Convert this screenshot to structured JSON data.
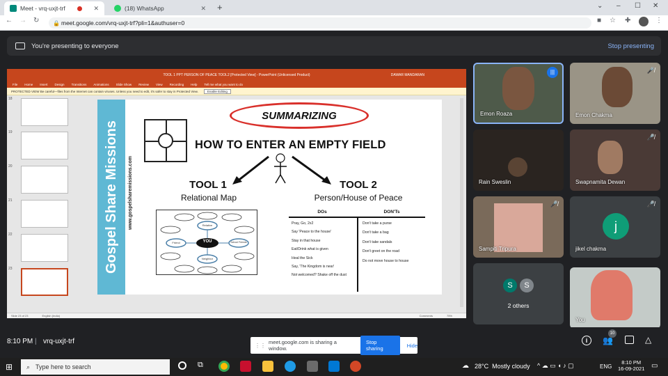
{
  "browser": {
    "tabs": [
      {
        "label": "Meet - vrq-uxjt-trf"
      },
      {
        "label": "(18) WhatsApp"
      }
    ],
    "new_tab": "+",
    "url": "meet.google.com/vrq-uxjt-trf?pli=1&authuser=0"
  },
  "banner": {
    "text": "You're presenting to everyone",
    "stop_label": "Stop presenting"
  },
  "ppt": {
    "title": "TOOL 1 PPT PERSON OF PEACE TOOL2 [Protected View] - PowerPoint (Unlicensed Product)",
    "user": "DAWAR MANDARAN",
    "menu": [
      "File",
      "Home",
      "Insert",
      "Design",
      "Transitions",
      "Animations",
      "Slide Show",
      "Review",
      "View",
      "Recording",
      "Help",
      "Tell me what you want to do"
    ],
    "warning": "PROTECTED VIEW  Be careful—files from the Internet can contain viruses. Unless you need to edit, it's safer to stay in Protected View.",
    "enable_editing": "Enable Editing",
    "status_left": "Slide 23 of 23",
    "status_lang": "English (India)",
    "status_right": "Comments",
    "zoom": "75%",
    "thumb_numbers": [
      "18",
      "19",
      "20",
      "21",
      "22",
      "23"
    ]
  },
  "slide": {
    "sidebar_title": "Gospel Share Missions",
    "sidebar_url": "www.gospelsharemissions.com",
    "heading": "SUMMARIZING",
    "subheading": "HOW TO ENTER AN EMPTY FIELD",
    "tool1": "TOOL 1",
    "tool1_sub": "Relational Map",
    "tool2": "TOOL 2",
    "tool2_sub": "Person/House of Peace",
    "map_center": "YOU",
    "map_nodes": [
      "Relative",
      "Friend",
      "School Friends",
      "Neighbor"
    ],
    "dos_header": "DOs",
    "donts_header": "DON'Ts",
    "dos": [
      "Pray, Go, 2x2",
      "Say 'Peace to the house'",
      "Stay in that house",
      "Eat/Drink what is given",
      "Heal the Sick",
      "Say, 'The Kingdom is near'",
      "Not welcomed? Shake off the dust"
    ],
    "donts": [
      "Don't take a purse",
      "Don't take a bag",
      "Don't take sandals",
      "Don't greet on the road",
      "Do not move house to house"
    ]
  },
  "participants": [
    {
      "name": "Emon Roaza",
      "muted": false
    },
    {
      "name": "Emon Chakma",
      "muted": true
    },
    {
      "name": "Rain Sweslin",
      "muted": false
    },
    {
      "name": "Swapnamita Dewan",
      "muted": true
    },
    {
      "name": "Sampiti Tripura",
      "muted": true
    },
    {
      "name": "jikel chakma",
      "muted": true,
      "initial": "j"
    },
    {
      "name": "2 others",
      "initials": [
        "S",
        "S"
      ]
    },
    {
      "name": "You"
    }
  ],
  "bottom": {
    "time": "8:10 PM",
    "meeting_code": "vrq-uxjt-trf",
    "people_count": "10",
    "share_message": "meet.google.com is sharing a window.",
    "stop_sharing": "Stop sharing",
    "hide": "Hide"
  },
  "taskbar": {
    "search_placeholder": "Type here to search",
    "weather": "28°C  Mostly cloudy",
    "lang": "ENG",
    "time": "8:10 PM",
    "date": "16-09-2021"
  },
  "colors": {
    "ppt_orange": "#c6461d",
    "meet_blue": "#8ab4f8",
    "slide_teal": "#5fb8d4"
  }
}
